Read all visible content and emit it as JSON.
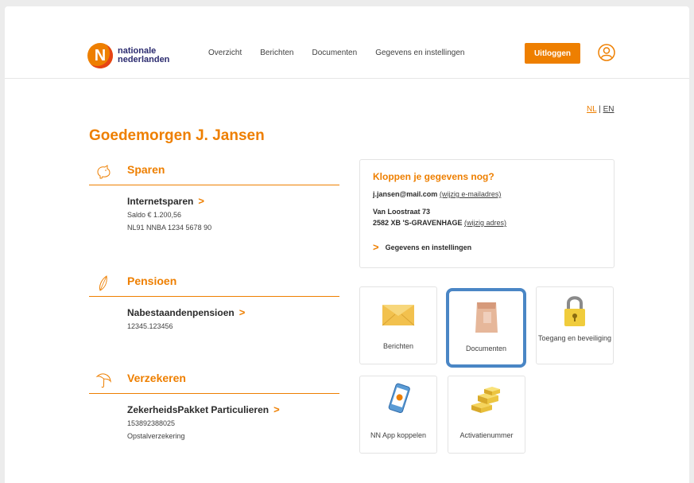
{
  "header": {
    "logo_line1": "nationale",
    "logo_line2": "nederlanden",
    "logo_mark": "N",
    "nav": [
      "Overzicht",
      "Berichten",
      "Documenten",
      "Gegevens en instellingen"
    ],
    "logout_label": "Uitloggen",
    "user_icon": "user-circle-icon"
  },
  "language": {
    "nl": "NL",
    "separator": "|",
    "en": "EN"
  },
  "greeting": "Goedemorgen J. Jansen",
  "sections": [
    {
      "title": "Sparen",
      "icon": "piggy-bank-icon",
      "product": "Internetsparen",
      "lines": [
        "Saldo € 1.200,56",
        "NL91 NNBA 1234 5678 90"
      ]
    },
    {
      "title": "Pensioen",
      "icon": "leaf-icon",
      "product": "Nabestaandenpensioen",
      "lines": [
        "12345.123456"
      ]
    },
    {
      "title": "Verzekeren",
      "icon": "umbrella-icon",
      "product": "ZekerheidsPakket Particulieren",
      "lines": [
        "153892388025",
        "Opstalverzekering"
      ]
    }
  ],
  "info": {
    "title": "Kloppen je gegevens nog?",
    "email": "j.jansen@mail.com",
    "email_link": "(wijzig e-mailadres)",
    "street": "Van Loostraat 73",
    "city": "2582 XB 'S-GRAVENHAGE",
    "address_link": "(wijzig adres)",
    "settings_link": "Gegevens en instellingen"
  },
  "tiles": [
    {
      "label": "Berichten",
      "icon": "envelope-icon"
    },
    {
      "label": "Documenten",
      "icon": "document-bag-icon",
      "selected": true
    },
    {
      "label": "Toegang en beveiliging",
      "icon": "padlock-icon"
    },
    {
      "label": "NN App koppelen",
      "icon": "phone-app-icon"
    },
    {
      "label": "Activatienummer",
      "icon": "gold-bars-icon"
    }
  ],
  "colors": {
    "accent": "#ee7f00",
    "selection": "#4a86c5"
  }
}
